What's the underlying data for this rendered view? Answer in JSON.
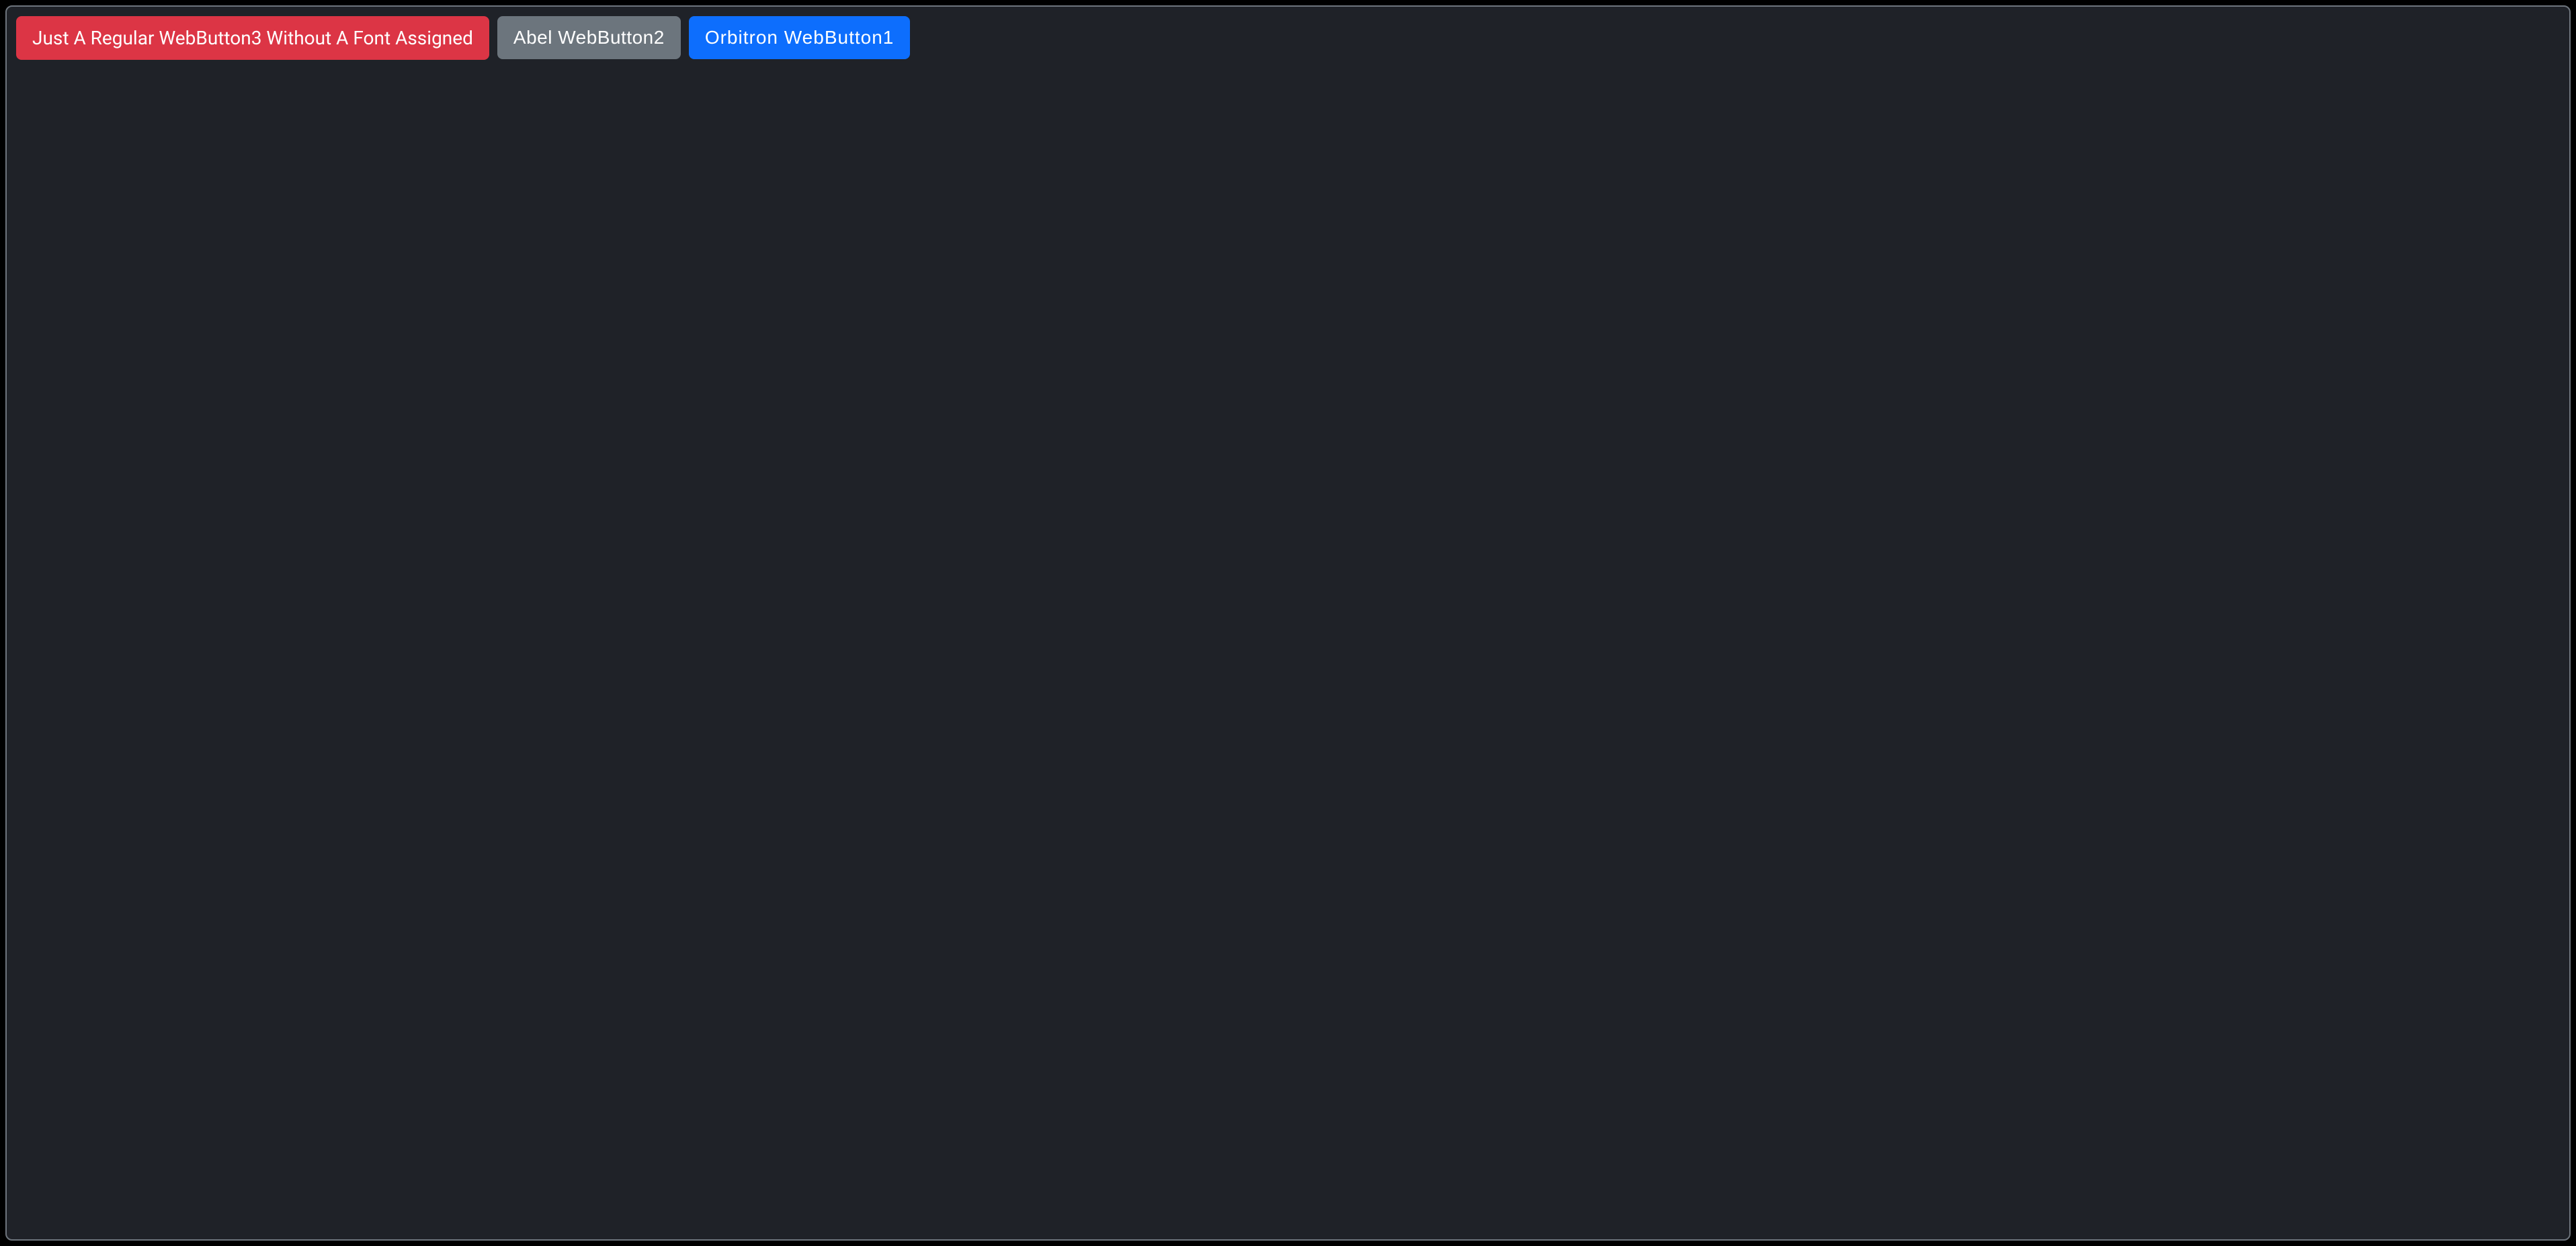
{
  "buttons": {
    "regular": {
      "label": "Just A Regular WebButton3 Without A Font Assigned",
      "color": "#dc3545"
    },
    "abel": {
      "label": "Abel WebButton2",
      "color": "#6c757d"
    },
    "orbitron": {
      "label": "Orbitron WebButton1",
      "color": "#0d6efd"
    }
  },
  "colors": {
    "background": "#1f2228",
    "border": "#6e757d",
    "page": "#000000"
  }
}
